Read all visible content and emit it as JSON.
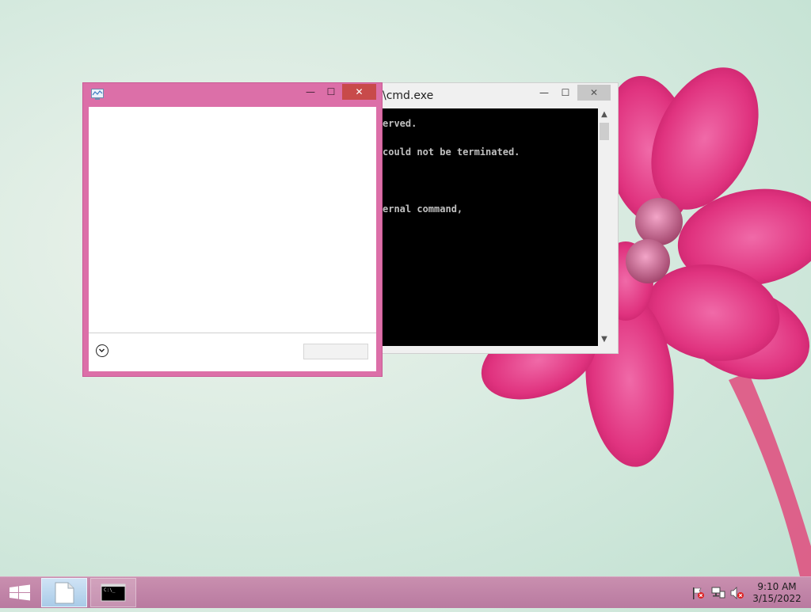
{
  "cmd_window": {
    "title": "\\cmd.exe",
    "min_glyph": "—",
    "max_glyph": "☐",
    "close_glyph": "✕",
    "lines": [
      "erved.",
      "could not be terminated.",
      "ernal command,"
    ],
    "scroll_up_glyph": "▲",
    "scroll_down_glyph": "▼"
  },
  "dialog_window": {
    "min_glyph": "—",
    "max_glyph": "☐",
    "close_glyph": "✕",
    "expand_glyph": "⌄"
  },
  "taskbar": {
    "items": [
      {
        "icon": "blank-document-icon",
        "active": true
      },
      {
        "icon": "command-prompt-icon",
        "active": false
      }
    ],
    "cmd_icon_text": "C:\\_",
    "tray": {
      "icons": [
        "action-center-flag-icon",
        "network-icon",
        "volume-muted-icon"
      ]
    },
    "clock": {
      "time": "9:10 AM",
      "date": "3/15/2022"
    }
  },
  "colors": {
    "dialog_frame": "#dc6fa8",
    "dialog_close": "#c84a4a",
    "taskbar": "#c08aa8",
    "console_bg": "#000000",
    "console_text": "#c0c0c0"
  }
}
